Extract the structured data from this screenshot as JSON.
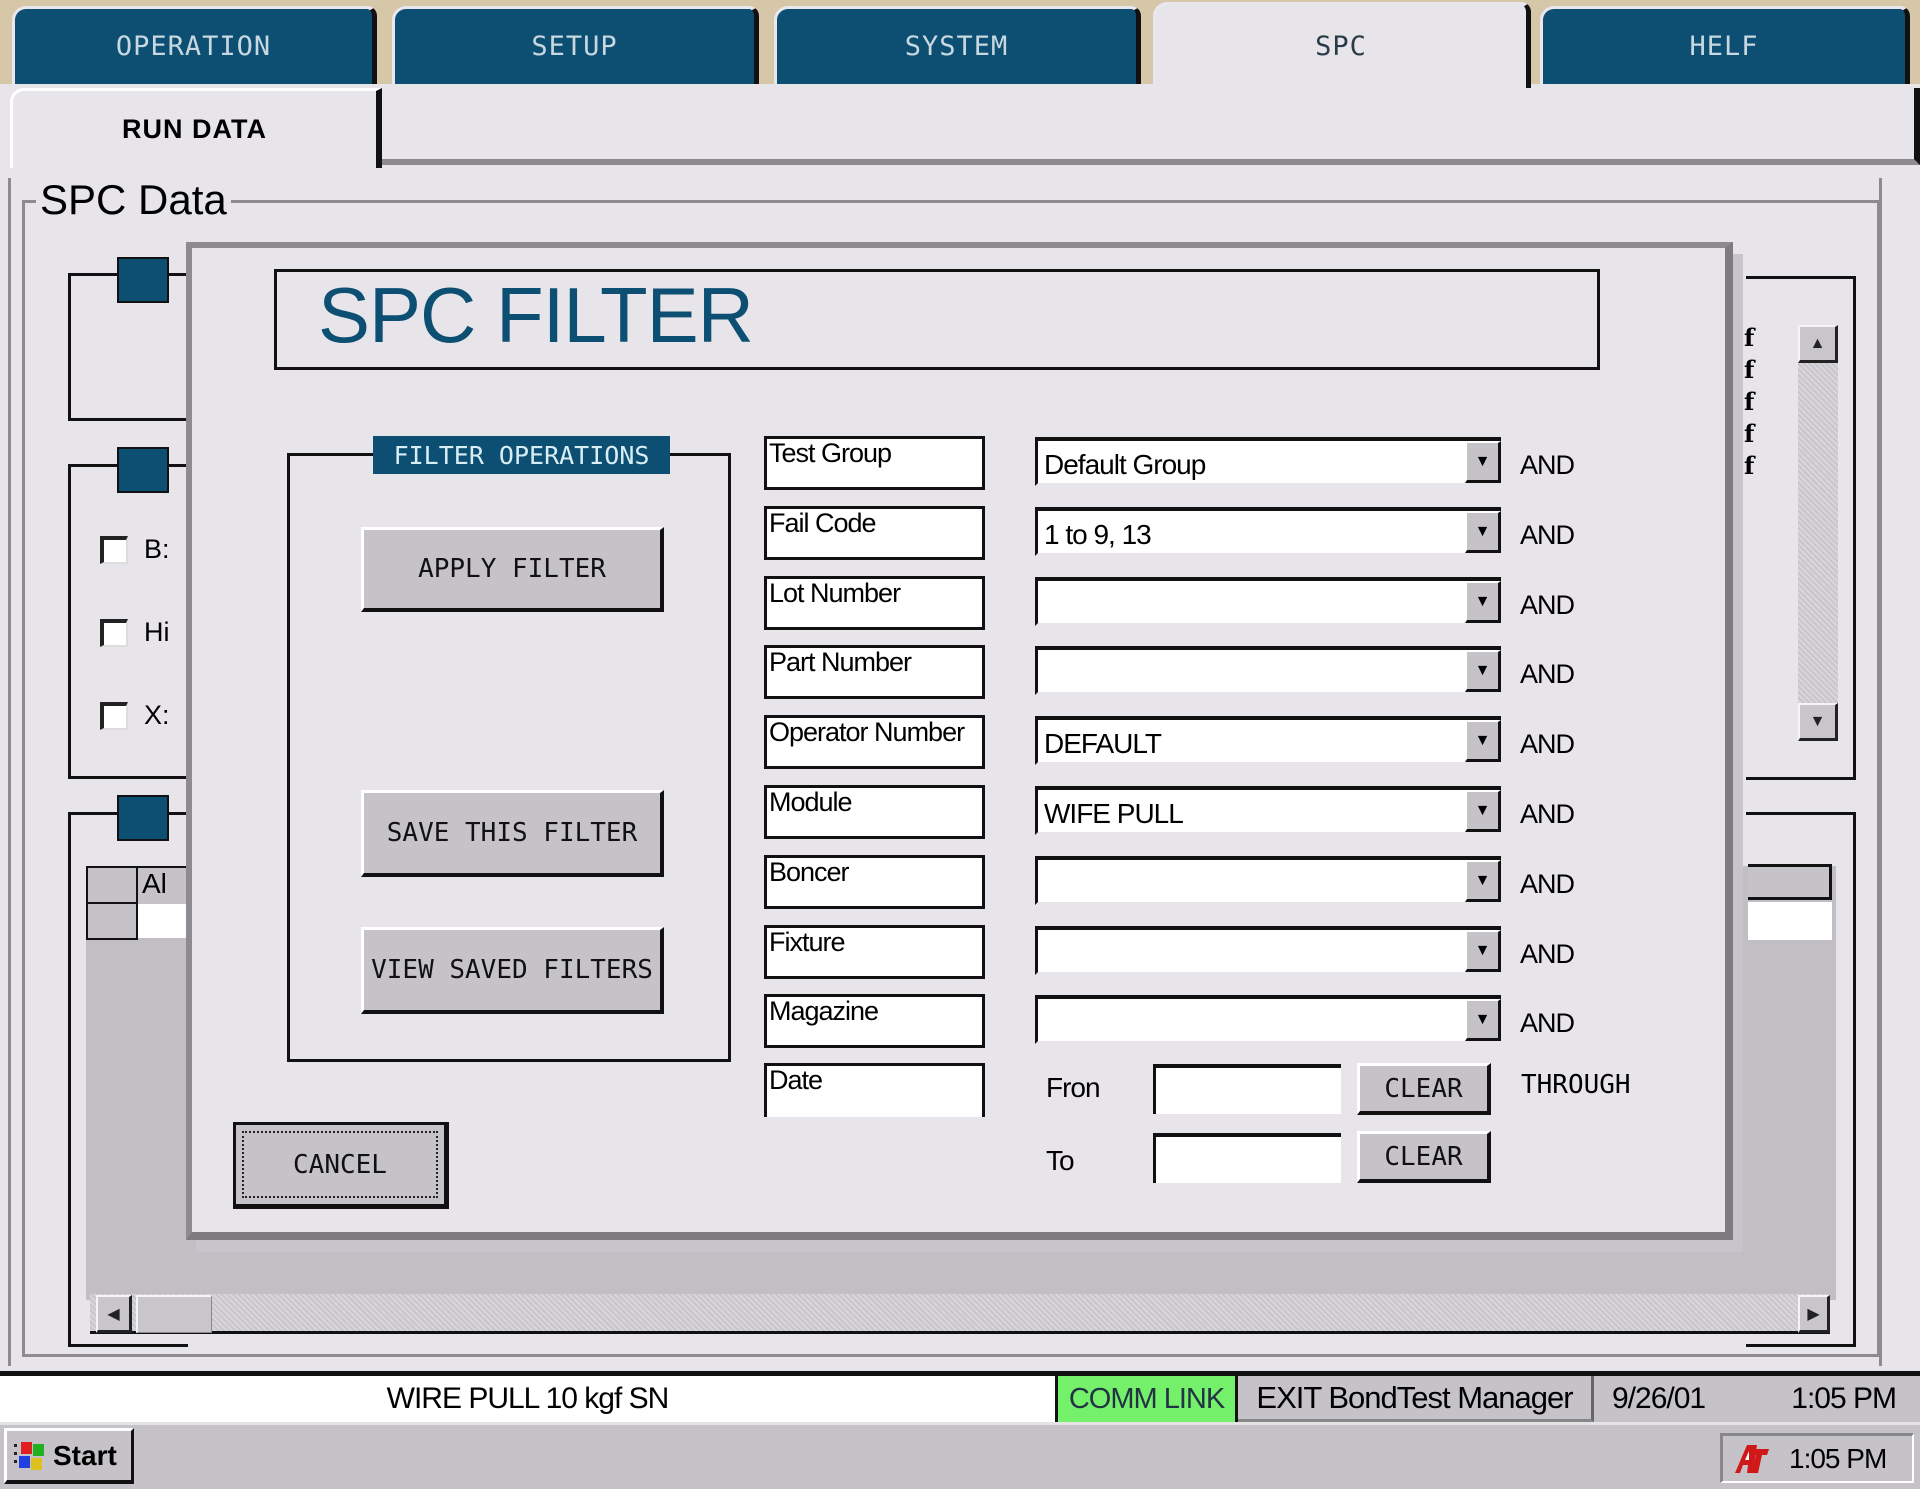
{
  "tabs": [
    {
      "label": "OPERATION",
      "active": false
    },
    {
      "label": "SETUP",
      "active": false
    },
    {
      "label": "SYSTEM",
      "active": false
    },
    {
      "label": "SPC",
      "active": true
    },
    {
      "label": "HELF",
      "active": false
    }
  ],
  "subtab": {
    "label": "RUN DATA"
  },
  "spc_group": {
    "label": "SPC Data"
  },
  "background": {
    "checkboxes": [
      {
        "label": "B:",
        "checked": false
      },
      {
        "label": "Hi",
        "checked": false
      },
      {
        "label": "X:",
        "checked": false
      }
    ],
    "grid_header_fragment": "Al",
    "right_list_items": [
      "f",
      "f",
      "f",
      "f",
      "f"
    ]
  },
  "dialog": {
    "title": "SPC FILTER",
    "filter_operations": {
      "legend": "FILTER OPERATIONS",
      "apply_label": "APPLY FILTER",
      "save_label": "SAVE THIS FILTER",
      "view_label": "VIEW SAVED FILTERS"
    },
    "cancel_label": "CANCEL",
    "fields": [
      {
        "label": "Test Group",
        "value": "Default Group",
        "connector": "AND"
      },
      {
        "label": "Fail Code",
        "value": "1 to 9, 13",
        "connector": "AND"
      },
      {
        "label": "Lot Number",
        "value": "",
        "connector": "AND"
      },
      {
        "label": "Part Number",
        "value": "",
        "connector": "AND"
      },
      {
        "label": "Operator Number",
        "value": "DEFAULT",
        "connector": "AND"
      },
      {
        "label": "Module",
        "value": "WIFE PULL",
        "connector": "AND"
      },
      {
        "label": "Boncer",
        "value": "",
        "connector": "AND"
      },
      {
        "label": "Fixture",
        "value": "",
        "connector": "AND"
      },
      {
        "label": "Magazine",
        "value": "",
        "connector": "AND"
      }
    ],
    "date": {
      "label": "Date",
      "from_label": "Fron",
      "from_value": "",
      "to_label": "To",
      "to_value": "",
      "clear_label": "CLEAR",
      "through_label": "THROUGH"
    }
  },
  "statusbar": {
    "main_text": "WIRE PULL 10 kgf   SN",
    "comm_link": "COMM LINK",
    "comm_color": "#74f06a",
    "exit_label": "EXIT BondTest Manager",
    "date": "9/26/01",
    "time": "1:05 PM"
  },
  "taskbar": {
    "start_label": "Start",
    "tray_time": "1:05 PM"
  },
  "colors": {
    "accent": "#0d4f73",
    "background": "#e8e5ea",
    "button": "#c6c3c8"
  }
}
